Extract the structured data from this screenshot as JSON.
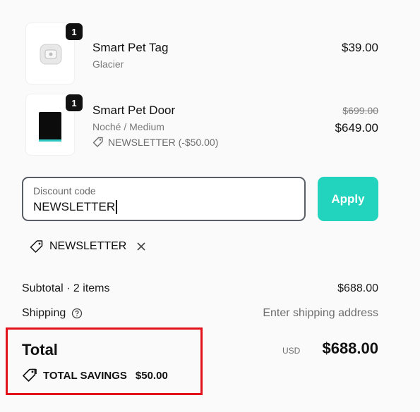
{
  "items": [
    {
      "qty": "1",
      "name": "Smart Pet Tag",
      "variant": "Glacier",
      "price": "$39.00",
      "image_icon": "pet-tag-image",
      "colors": {
        "device": "#e8e8e8",
        "accent": "#cfcfcf"
      }
    },
    {
      "qty": "1",
      "name": "Smart Pet Door",
      "variant": "Noché / Medium",
      "original_price": "$699.00",
      "price": "$649.00",
      "discount_note": "NEWSLETTER (-$50.00)",
      "image_icon": "pet-door-image",
      "colors": {
        "device": "#0c0c0c",
        "accent": "#2ec7c2"
      }
    }
  ],
  "discount": {
    "label": "Discount code",
    "value": "NEWSLETTER",
    "apply_label": "Apply",
    "applied_code": "NEWSLETTER"
  },
  "summary": {
    "subtotal_label": "Subtotal · 2 items",
    "subtotal_value": "$688.00",
    "shipping_label": "Shipping",
    "shipping_value": "Enter shipping address",
    "total_label": "Total",
    "currency": "USD",
    "total_value": "$688.00",
    "savings_label": "TOTAL SAVINGS",
    "savings_value": "$50.00"
  },
  "colors": {
    "apply_button": "#22d3bd",
    "highlight_border": "#e3121a",
    "qty_badge": "#111111"
  }
}
